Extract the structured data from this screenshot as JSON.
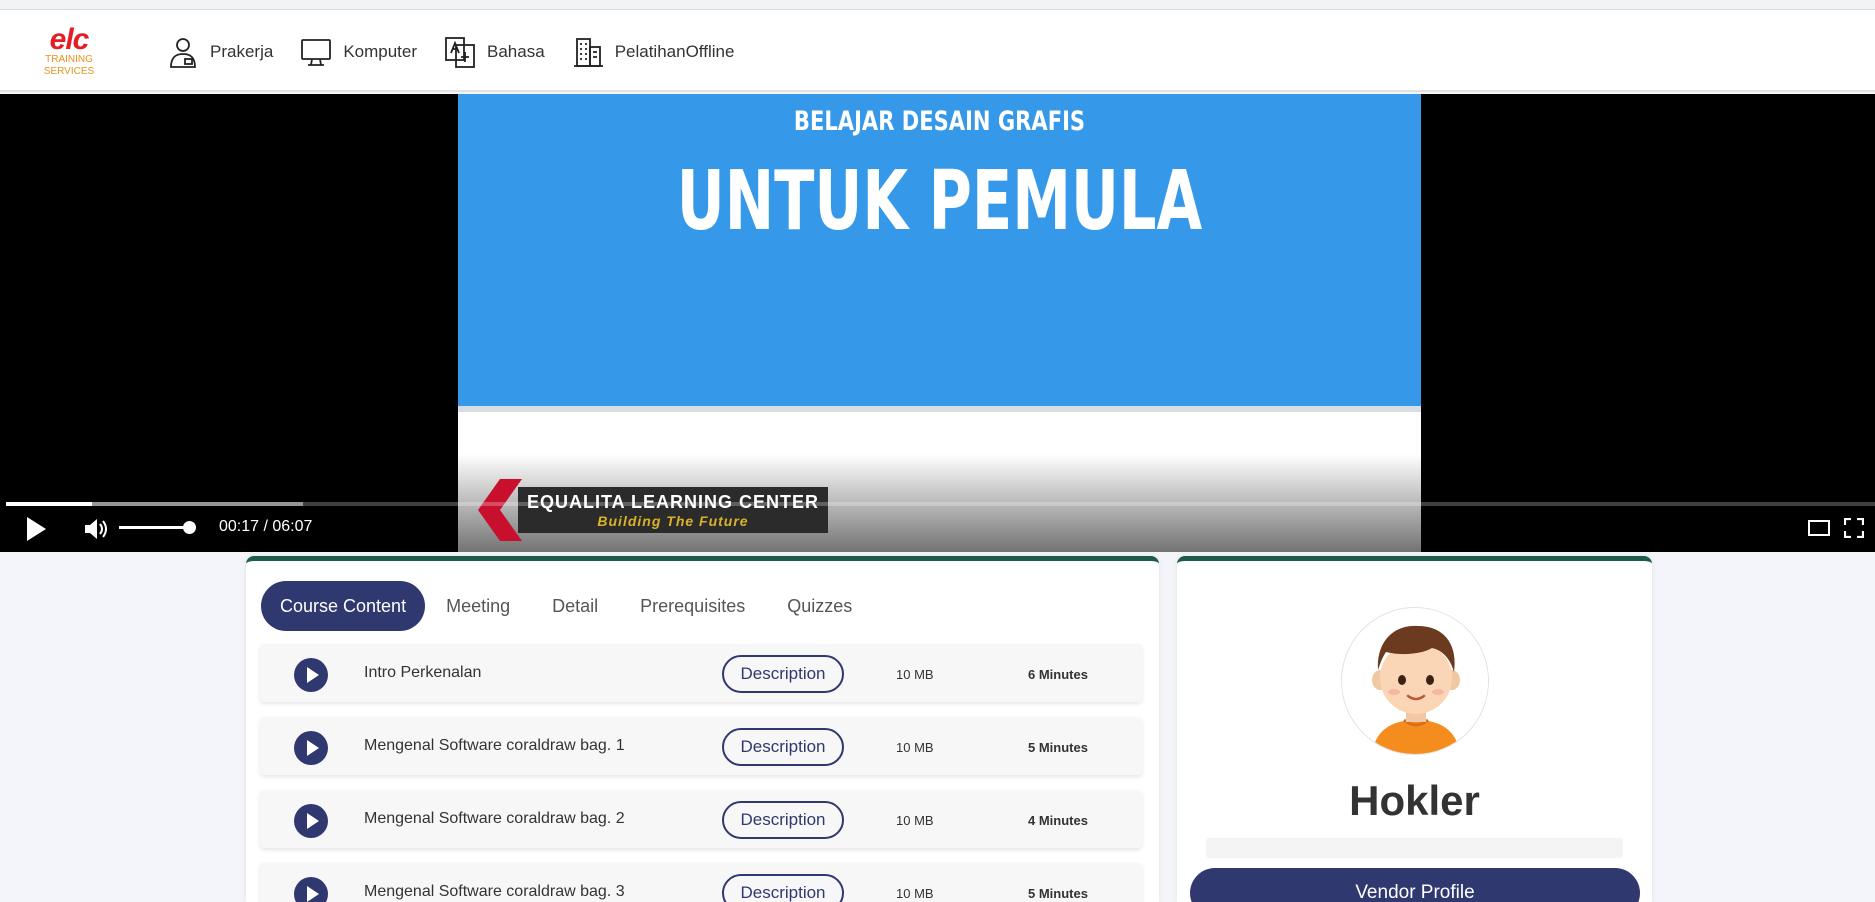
{
  "header": {
    "logo_text": "elc",
    "logo_sub_1": "TRAINING",
    "logo_sub_2": "SERVICES",
    "nav": [
      {
        "label": "Prakerja",
        "icon": "person-badge-icon"
      },
      {
        "label": "Komputer",
        "icon": "monitor-icon"
      },
      {
        "label": "Bahasa",
        "icon": "translate-icon"
      },
      {
        "label": "PelatihanOffline",
        "icon": "building-icon"
      }
    ]
  },
  "video": {
    "slide_subtitle": "BELAJAR DESAIN GRAFIS",
    "slide_title": "UNTUK PEMULA",
    "watermark_title": "EQUALITA LEARNING CENTER",
    "watermark_tagline": "Building The Future",
    "time_display": "00:17 / 06:07",
    "played_fraction": 0.046,
    "buffered_fraction": 0.159,
    "volume_fraction": 1.0
  },
  "course": {
    "tabs": [
      "Course Content",
      "Meeting",
      "Detail",
      "Prerequisites",
      "Quizzes"
    ],
    "active_tab": "Course Content",
    "description_label": "Description",
    "lessons": [
      {
        "title": "Intro Perkenalan",
        "size": "10 MB",
        "duration": "6 Minutes"
      },
      {
        "title": "Mengenal Software coraldraw bag. 1",
        "size": "10 MB",
        "duration": "5 Minutes"
      },
      {
        "title": "Mengenal Software coraldraw bag. 2",
        "size": "10 MB",
        "duration": "4 Minutes"
      },
      {
        "title": "Mengenal Software coraldraw bag. 3",
        "size": "10 MB",
        "duration": "5 Minutes"
      }
    ]
  },
  "vendor": {
    "name": "Hokler",
    "button_label": "Vendor Profile"
  },
  "colors": {
    "primary": "#303870",
    "card_accent": "#1d5c4b",
    "slide_blue": "#3698e8",
    "logo_red": "#e31e24",
    "logo_orange": "#e8931a"
  }
}
